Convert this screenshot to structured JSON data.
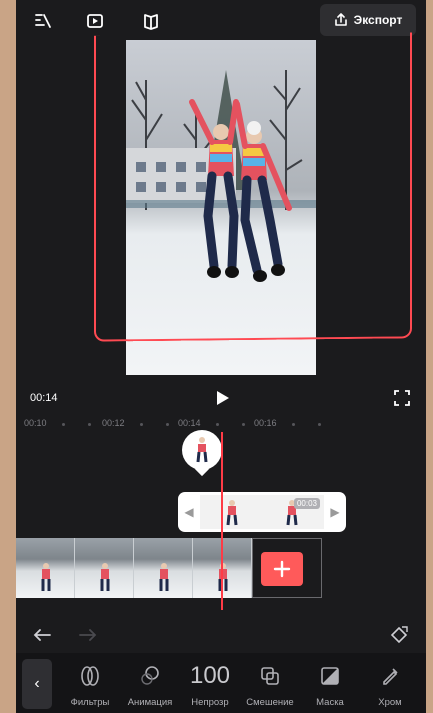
{
  "topbar": {
    "export_label": "Экспорт"
  },
  "preview": {
    "current_time": "00:14"
  },
  "timeline": {
    "ruler": [
      "00:10",
      "00:12",
      "00:14",
      "00:16"
    ],
    "overlay_duration": "00:03"
  },
  "toolbar": {
    "back_label": "‹",
    "tools": [
      {
        "label": "Фильтры",
        "icon": "filters-icon"
      },
      {
        "label": "Анимация",
        "icon": "animation-icon"
      },
      {
        "label": "Непрозр",
        "value": "100",
        "icon": "opacity-value"
      },
      {
        "label": "Смешение",
        "icon": "blend-icon"
      },
      {
        "label": "Маска",
        "icon": "mask-icon"
      },
      {
        "label": "Хром",
        "icon": "chroma-icon"
      }
    ]
  },
  "colors": {
    "accent_red": "#ff4a52",
    "background": "#1b1b1d",
    "add_button": "#ff5a5a"
  }
}
